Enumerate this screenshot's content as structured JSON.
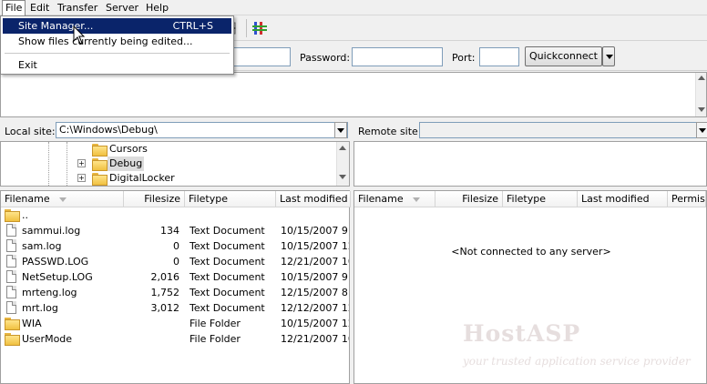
{
  "menubar": {
    "items": [
      {
        "label": "File",
        "open": true
      },
      {
        "label": "Edit"
      },
      {
        "label": "Transfer"
      },
      {
        "label": "Server"
      },
      {
        "label": "Help"
      }
    ]
  },
  "file_menu": {
    "items": [
      {
        "label": "Site Manager...",
        "shortcut": "CTRL+S",
        "highlighted": true
      },
      {
        "label": "Show files currently being edited..."
      },
      {
        "label": "Exit"
      }
    ]
  },
  "quickconnect": {
    "password_label": "Password:",
    "port_label": "Port:",
    "button_label": "Quickconnect"
  },
  "local": {
    "site_label": "Local site:",
    "path": "C:\\Windows\\Debug\\",
    "tree": [
      {
        "label": "Cursors",
        "expandable": false,
        "selected": false
      },
      {
        "label": "Debug",
        "expandable": true,
        "selected": true
      },
      {
        "label": "DigitalLocker",
        "expandable": true,
        "selected": false
      }
    ],
    "columns": [
      "Filename",
      "Filesize",
      "Filetype",
      "Last modified"
    ],
    "files": [
      {
        "name": "..",
        "size": "",
        "type": "",
        "modified": "",
        "icon": "folder"
      },
      {
        "name": "sammui.log",
        "size": "134",
        "type": "Text Document",
        "modified": "10/15/2007 9:2",
        "icon": "doc"
      },
      {
        "name": "sam.log",
        "size": "0",
        "type": "Text Document",
        "modified": "10/15/2007 12:",
        "icon": "doc"
      },
      {
        "name": "PASSWD.LOG",
        "size": "0",
        "type": "Text Document",
        "modified": "12/21/2007 10:",
        "icon": "doc"
      },
      {
        "name": "NetSetup.LOG",
        "size": "2,016",
        "type": "Text Document",
        "modified": "10/15/2007 9:4",
        "icon": "doc"
      },
      {
        "name": "mrteng.log",
        "size": "1,752",
        "type": "Text Document",
        "modified": "12/15/2007 8:4",
        "icon": "doc"
      },
      {
        "name": "mrt.log",
        "size": "3,012",
        "type": "Text Document",
        "modified": "12/12/2007 12:",
        "icon": "doc"
      },
      {
        "name": "WIA",
        "size": "",
        "type": "File Folder",
        "modified": "10/15/2007 12:",
        "icon": "folder"
      },
      {
        "name": "UserMode",
        "size": "",
        "type": "File Folder",
        "modified": "12/21/2007 10:",
        "icon": "folder"
      }
    ]
  },
  "remote": {
    "site_label": "Remote site:",
    "columns": [
      "Filename",
      "Filesize",
      "Filetype",
      "Last modified",
      "Permiss"
    ],
    "status": "<Not connected to any server>"
  },
  "watermark": {
    "title": "HostASP",
    "subtitle": "your trusted application service provider"
  }
}
